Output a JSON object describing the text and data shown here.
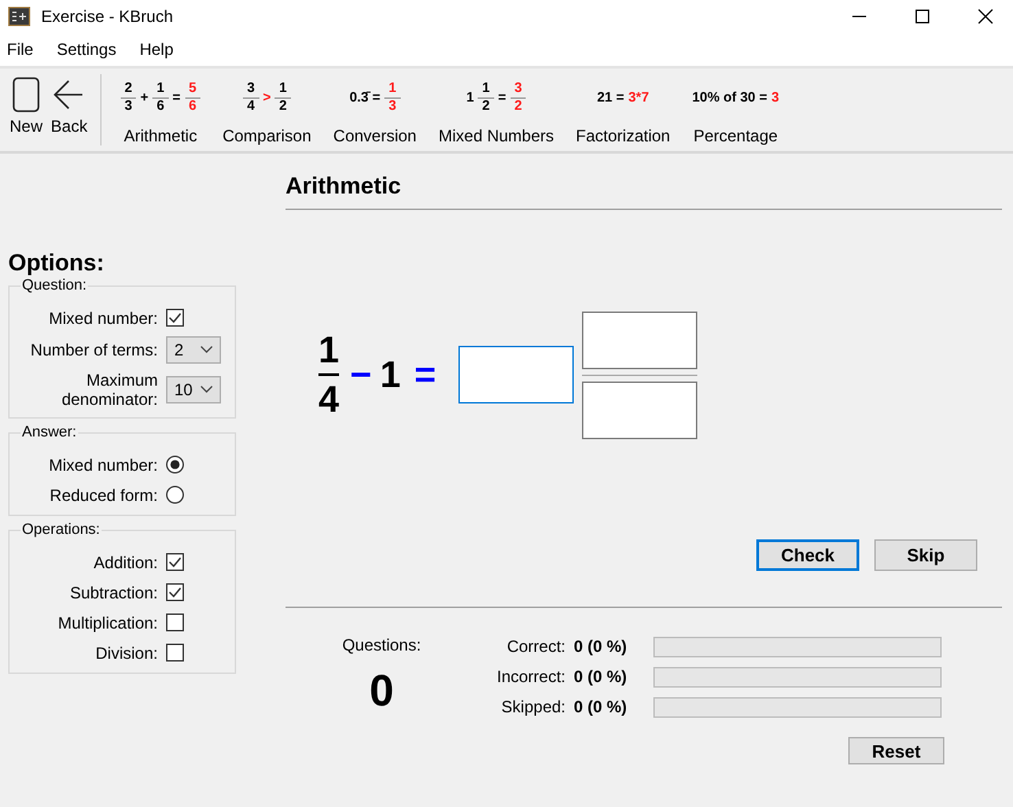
{
  "window": {
    "title": "Exercise - KBruch"
  },
  "menu": [
    "File",
    "Settings",
    "Help"
  ],
  "toolbar": {
    "actions": [
      {
        "label": "New",
        "kind": "new"
      },
      {
        "label": "Back",
        "kind": "back"
      }
    ],
    "modes": [
      {
        "label": "Arithmetic",
        "formula": [
          {
            "kind": "frac",
            "num": "2",
            "den": "3",
            "accent": false
          },
          {
            "kind": "text",
            "text": "+",
            "accent": false
          },
          {
            "kind": "frac",
            "num": "1",
            "den": "6",
            "accent": false
          },
          {
            "kind": "text",
            "text": "=",
            "accent": false
          },
          {
            "kind": "frac",
            "num": "5",
            "den": "6",
            "accent": true
          }
        ]
      },
      {
        "label": "Comparison",
        "formula": [
          {
            "kind": "frac",
            "num": "3",
            "den": "4",
            "accent": false
          },
          {
            "kind": "text",
            "text": ">",
            "accent": true
          },
          {
            "kind": "frac",
            "num": "1",
            "den": "2",
            "accent": false
          }
        ]
      },
      {
        "label": "Conversion",
        "formula": [
          {
            "kind": "text",
            "text": "0.3̄ =",
            "accent": false
          },
          {
            "kind": "frac",
            "num": "1",
            "den": "3",
            "accent": true
          }
        ]
      },
      {
        "label": "Mixed Numbers",
        "formula": [
          {
            "kind": "text",
            "text": "1",
            "accent": false
          },
          {
            "kind": "frac",
            "num": "1",
            "den": "2",
            "accent": false
          },
          {
            "kind": "text",
            "text": "=",
            "accent": false
          },
          {
            "kind": "frac",
            "num": "3",
            "den": "2",
            "accent": true
          }
        ]
      },
      {
        "label": "Factorization",
        "formula": [
          {
            "kind": "text",
            "text": "21 =",
            "accent": false
          },
          {
            "kind": "text",
            "text": "3*7",
            "accent": true
          }
        ]
      },
      {
        "label": "Percentage",
        "formula": [
          {
            "kind": "text",
            "text": "10% of 30 =",
            "accent": false
          },
          {
            "kind": "text",
            "text": "3",
            "accent": true
          }
        ]
      }
    ]
  },
  "options": {
    "title": "Options:",
    "groups": [
      {
        "title": "Question:",
        "rows": [
          {
            "kind": "checkbox",
            "label": "Mixed number:",
            "checked": true
          },
          {
            "kind": "select",
            "label": "Number of terms:",
            "value": "2"
          },
          {
            "kind": "select",
            "label": "Maximum denominator:",
            "value": "10"
          }
        ]
      },
      {
        "title": "Answer:",
        "rows": [
          {
            "kind": "radio",
            "label": "Mixed number:",
            "selected": true
          },
          {
            "kind": "radio",
            "label": "Reduced form:",
            "selected": false
          }
        ]
      },
      {
        "title": "Operations:",
        "rows": [
          {
            "kind": "checkbox",
            "label": "Addition:",
            "checked": true
          },
          {
            "kind": "checkbox",
            "label": "Subtraction:",
            "checked": true
          },
          {
            "kind": "checkbox",
            "label": "Multiplication:",
            "checked": false
          },
          {
            "kind": "checkbox",
            "label": "Division:",
            "checked": false
          }
        ]
      }
    ]
  },
  "exercise": {
    "title": "Arithmetic",
    "task": [
      {
        "kind": "frac",
        "num": "1",
        "den": "4"
      },
      {
        "kind": "op",
        "text": "−"
      },
      {
        "kind": "num",
        "text": "1"
      },
      {
        "kind": "op",
        "text": "="
      }
    ],
    "answer": {
      "whole_focused": true
    },
    "buttons": [
      {
        "label": "Check",
        "focused": true
      },
      {
        "label": "Skip",
        "focused": false
      }
    ]
  },
  "statistics": {
    "questions_label": "Questions:",
    "questions": "0",
    "rows": [
      {
        "label": "Correct:",
        "value": "0 (0 %)"
      },
      {
        "label": "Incorrect:",
        "value": "0 (0 %)"
      },
      {
        "label": "Skipped:",
        "value": "0 (0 %)"
      }
    ],
    "reset": "Reset"
  }
}
